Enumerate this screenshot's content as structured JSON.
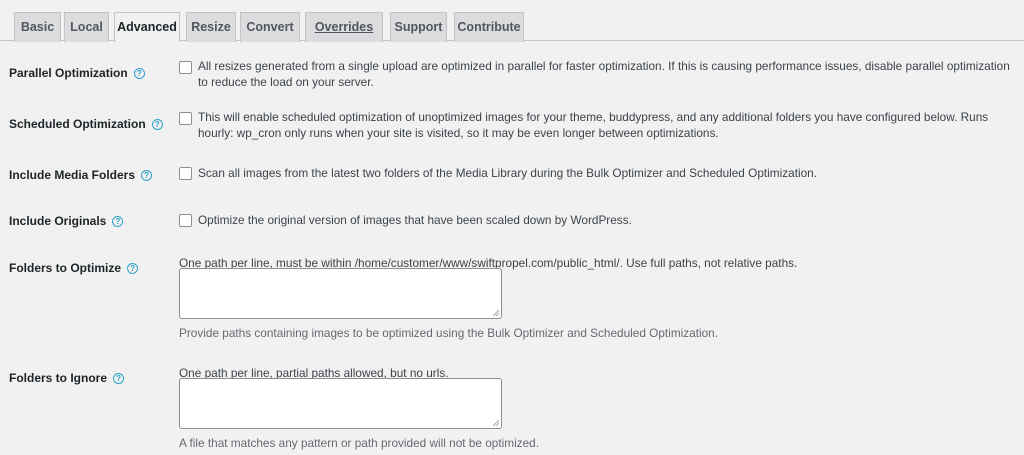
{
  "tabs": [
    {
      "label": "Basic"
    },
    {
      "label": "Local"
    },
    {
      "label": "Advanced"
    },
    {
      "label": "Resize"
    },
    {
      "label": "Convert"
    },
    {
      "label": "Overrides"
    },
    {
      "label": "Support"
    },
    {
      "label": "Contribute"
    }
  ],
  "active_tab": "Advanced",
  "settings": {
    "parallel": {
      "label": "Parallel Optimization",
      "desc": "All resizes generated from a single upload are optimized in parallel for faster optimization. If this is causing performance issues, disable parallel optimization to reduce the load on your server."
    },
    "scheduled": {
      "label": "Scheduled Optimization",
      "desc": "This will enable scheduled optimization of unoptimized images for your theme, buddypress, and any additional folders you have configured below. Runs hourly: wp_cron only runs when your site is visited, so it may be even longer between optimizations."
    },
    "media_folders": {
      "label": "Include Media Folders",
      "desc": "Scan all images from the latest two folders of the Media Library during the Bulk Optimizer and Scheduled Optimization."
    },
    "originals": {
      "label": "Include Originals",
      "desc": "Optimize the original version of images that have been scaled down by WordPress."
    },
    "folders_optimize": {
      "label": "Folders to Optimize",
      "hint": "One path per line, must be within /home/customer/www/swiftpropel.com/public_html/. Use full paths, not relative paths.",
      "value": "",
      "note": "Provide paths containing images to be optimized using the Bulk Optimizer and Scheduled Optimization."
    },
    "folders_ignore": {
      "label": "Folders to Ignore",
      "hint": "One path per line, partial paths allowed, but no urls.",
      "value": "",
      "note": "A file that matches any pattern or path provided will not be optimized."
    }
  },
  "help_glyph": "?",
  "colors": {
    "help": "#2ea2cc",
    "background": "#f1f1f1",
    "tab_inactive": "#dcdcde"
  }
}
